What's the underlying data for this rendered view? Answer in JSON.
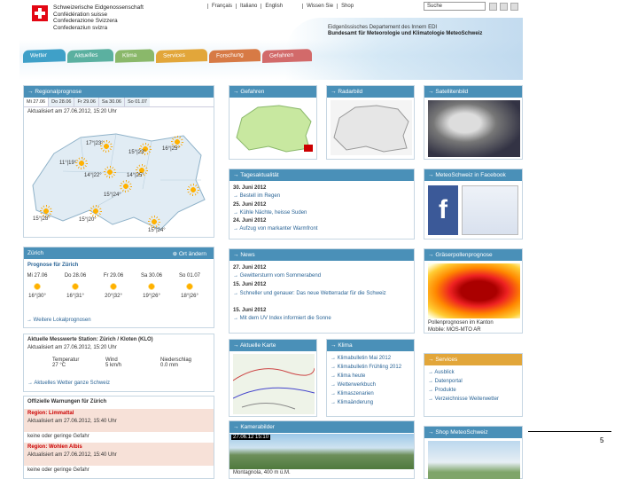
{
  "header": {
    "conf": [
      "Schweizerische Eidgenossenschaft",
      "Confédération suisse",
      "Confederazione Svizzera",
      "Confederaziun svizra"
    ],
    "lang": [
      "Français",
      "Italiano",
      "English",
      "Wissen Sie",
      "Shop"
    ],
    "search_placeholder": "Suche",
    "dept_line1": "Eidgenössisches Departement des Innern EDI",
    "dept_line2": "Bundesamt für Meteorologie und Klimatologie MeteoSchweiz"
  },
  "tabs": [
    {
      "label": "Wetter",
      "color": "#3fa0c8"
    },
    {
      "label": "Aktuelles",
      "color": "#5bb0a0"
    },
    {
      "label": "Klima",
      "color": "#8ab86a"
    },
    {
      "label": "Services",
      "color": "#e2a63a"
    },
    {
      "label": "Forschung",
      "color": "#d77a45"
    },
    {
      "label": "Gefahren",
      "color": "#d26a6a"
    }
  ],
  "regio": {
    "title": "Regionalprognose",
    "days": [
      "Mi 27.06",
      "Do 28.06",
      "Fr 29.06",
      "Sa 30.06",
      "So 01.07"
    ],
    "updated": "Aktualisiert am 27.06.2012, 15:20 Uhr",
    "temps": [
      "17°|23°",
      "15°|23°",
      "16°|25°",
      "11°|19°",
      "14°|22°",
      "14°|25°",
      "15°|24°",
      "15°|28°",
      "15°|20°",
      "15°|24°"
    ]
  },
  "zuerich": {
    "title": "Zürich",
    "other": "Ort ändern",
    "fc_title": "Prognose für Zürich",
    "days": [
      {
        "day": "Mi 27.06",
        "range": "16°|30°"
      },
      {
        "day": "Do 28.06",
        "range": "16°|31°"
      },
      {
        "day": "Fr 29.06",
        "range": "20°|32°"
      },
      {
        "day": "Sa 30.06",
        "range": "19°|26°"
      },
      {
        "day": "So 01.07",
        "range": "18°|26°"
      }
    ],
    "more": "Weitere Lokalprognosen"
  },
  "station": {
    "title": "Aktuelle Messwerte Station: Zürich / Kloten (KLO)",
    "updated": "Aktualisiert am 27.06.2012, 15:20 Uhr",
    "temp_label": "Temperatur",
    "temp_val": "27 °C",
    "wind_label": "Wind",
    "wind_val": "5 km/h",
    "rain_label": "Niederschlag",
    "rain_val": "0.0 mm",
    "more": "Aktuelles Wetter ganze Schweiz"
  },
  "warnings": {
    "title": "Offizielle Warnungen für Zürich",
    "r1": "Region: Limmattal",
    "u1": "Aktualisiert am 27.06.2012, 15:40 Uhr",
    "s1": "keine oder geringe Gefahr",
    "r2": "Region: Wohlen Albis",
    "u2": "Aktualisiert am 27.06.2012, 15:40 Uhr",
    "s2": "keine oder geringe Gefahr"
  },
  "panels": {
    "gefahren": "Gefahren",
    "radar": "Radarbild",
    "sat": "Satellitenbild",
    "tag": "Tagesaktualität",
    "facebook": "MeteoSchweiz in Facebook",
    "news": "News",
    "pollen": "Gräserpollenprognose",
    "aktuell_karte": "Aktuelle Karte",
    "klima": "Klima",
    "services": "Services",
    "kamera": "Kamerabilder",
    "shop": "Shop MeteoSchweiz"
  },
  "tages": [
    {
      "date": "30. Juni 2012",
      "text": "Bestell im Regen"
    },
    {
      "date": "25. Juni 2012",
      "text": "Kühle Nächte, heisse Suden"
    },
    {
      "date": "24. Juni 2012",
      "text": "Aufzug von markanter Warmfront"
    }
  ],
  "news": [
    {
      "date": "27. Juni 2012",
      "text": "Gewittersturm vom Sommerabend"
    },
    {
      "date": "15. Juni 2012",
      "text": "Schneller und genauer: Das neue Wetterradar für die Schweiz"
    },
    {
      "date": "15. Juni 2012",
      "text": "Mit dem UV Index informiert die Sonne"
    }
  ],
  "pollen_caption": "Pollenprognosen im Kanton",
  "pollen_link": "Mobile: MOS-MTO AR",
  "klima_links": [
    "Klimabulletin Mai 2012",
    "Klimabulletin Frühling 2012",
    "Klima heute",
    "Wetterwerkbuch",
    "Klimaszenarien",
    "Klimaänderung"
  ],
  "service_links": [
    "Ausblick",
    "Datenportal",
    "Produkte",
    "Verzeichnisse Weiterwetter"
  ],
  "kamera": {
    "stamp": "27.06.12 15:10",
    "caption": "Montagnola, 400 m ü.M."
  },
  "page_number": "5"
}
